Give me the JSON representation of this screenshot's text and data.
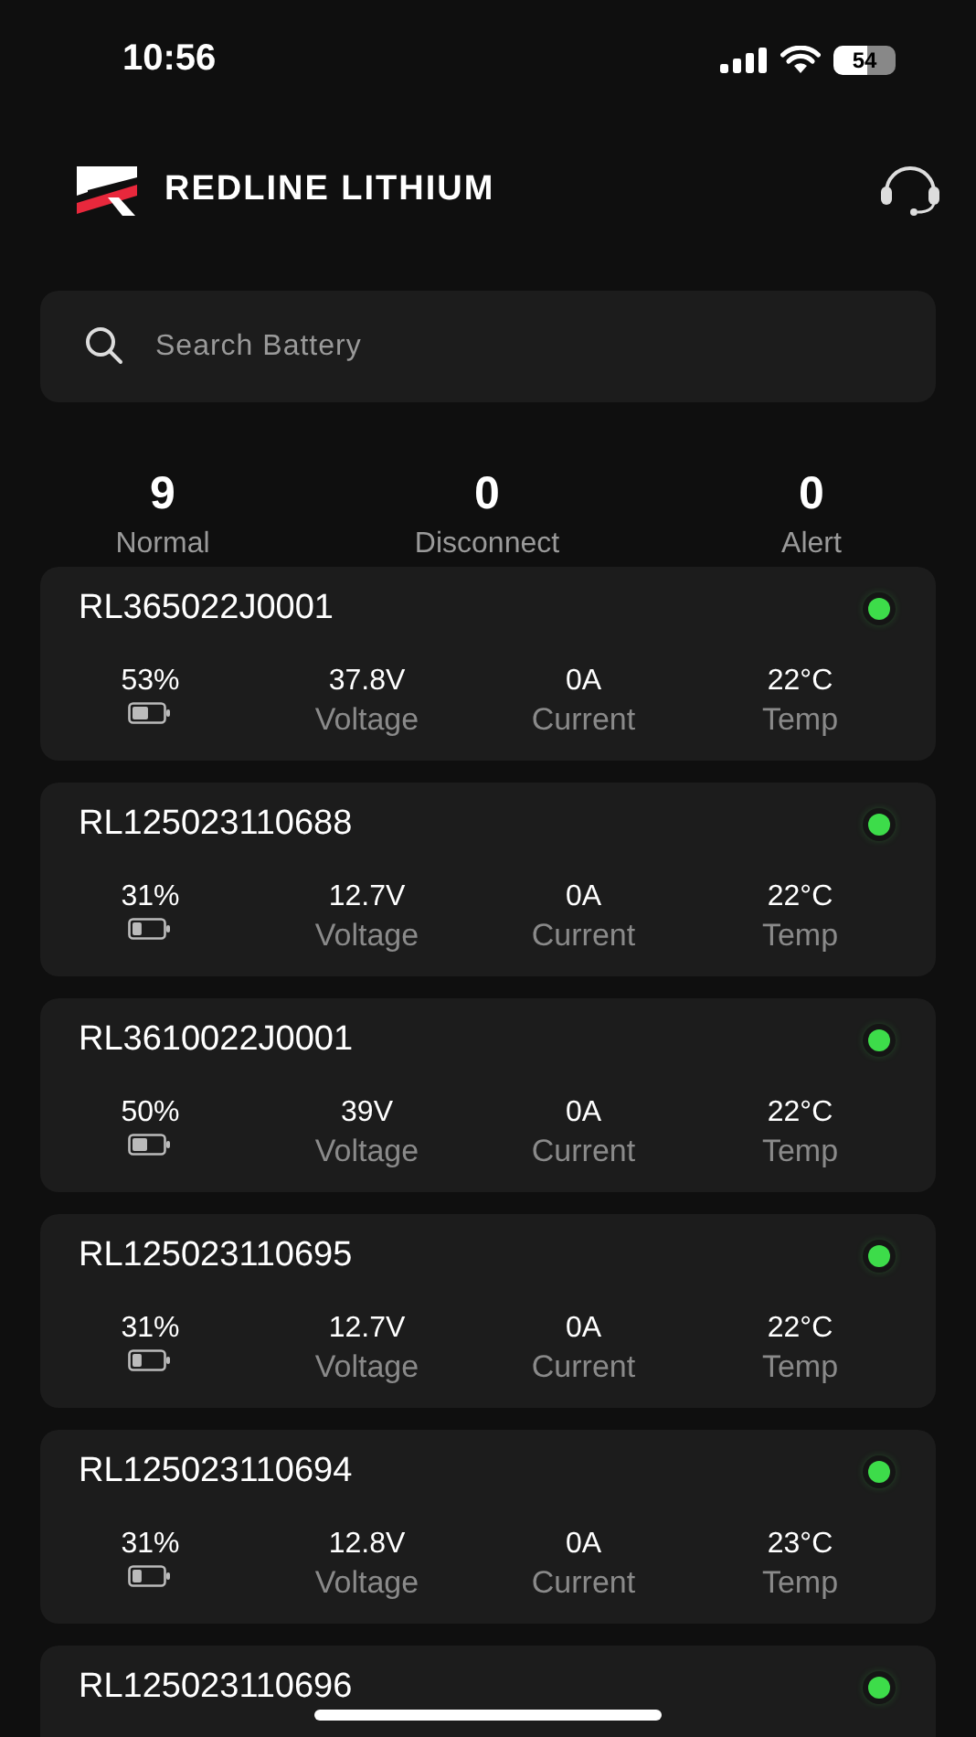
{
  "status_bar": {
    "time": "10:56",
    "battery": "54"
  },
  "header": {
    "brand": "REDLINE LITHIUM"
  },
  "search": {
    "placeholder": "Search Battery"
  },
  "summary": [
    {
      "count": "9",
      "label": "Normal"
    },
    {
      "count": "0",
      "label": "Disconnect"
    },
    {
      "count": "0",
      "label": "Alert"
    }
  ],
  "batteries": [
    {
      "name": "RL365022J0001",
      "color": "#3ddc4a",
      "charge": "53%",
      "level": 0.53,
      "voltage": "37.8V",
      "voltage_label": "Voltage",
      "current": "0A",
      "current_label": "Current",
      "temp": "22°C",
      "temp_label": "Temp"
    },
    {
      "name": "RL125023110688",
      "color": "#3ddc4a",
      "charge": "31%",
      "level": 0.31,
      "voltage": "12.7V",
      "voltage_label": "Voltage",
      "current": "0A",
      "current_label": "Current",
      "temp": "22°C",
      "temp_label": "Temp"
    },
    {
      "name": "RL3610022J0001",
      "color": "#3ddc4a",
      "charge": "50%",
      "level": 0.5,
      "voltage": "39V",
      "voltage_label": "Voltage",
      "current": "0A",
      "current_label": "Current",
      "temp": "22°C",
      "temp_label": "Temp"
    },
    {
      "name": "RL125023110695",
      "color": "#3ddc4a",
      "charge": "31%",
      "level": 0.31,
      "voltage": "12.7V",
      "voltage_label": "Voltage",
      "current": "0A",
      "current_label": "Current",
      "temp": "22°C",
      "temp_label": "Temp"
    },
    {
      "name": "RL125023110694",
      "color": "#3ddc4a",
      "charge": "31%",
      "level": 0.31,
      "voltage": "12.8V",
      "voltage_label": "Voltage",
      "current": "0A",
      "current_label": "Current",
      "temp": "23°C",
      "temp_label": "Temp"
    },
    {
      "name": "RL125023110696",
      "color": "#3ddc4a"
    }
  ]
}
